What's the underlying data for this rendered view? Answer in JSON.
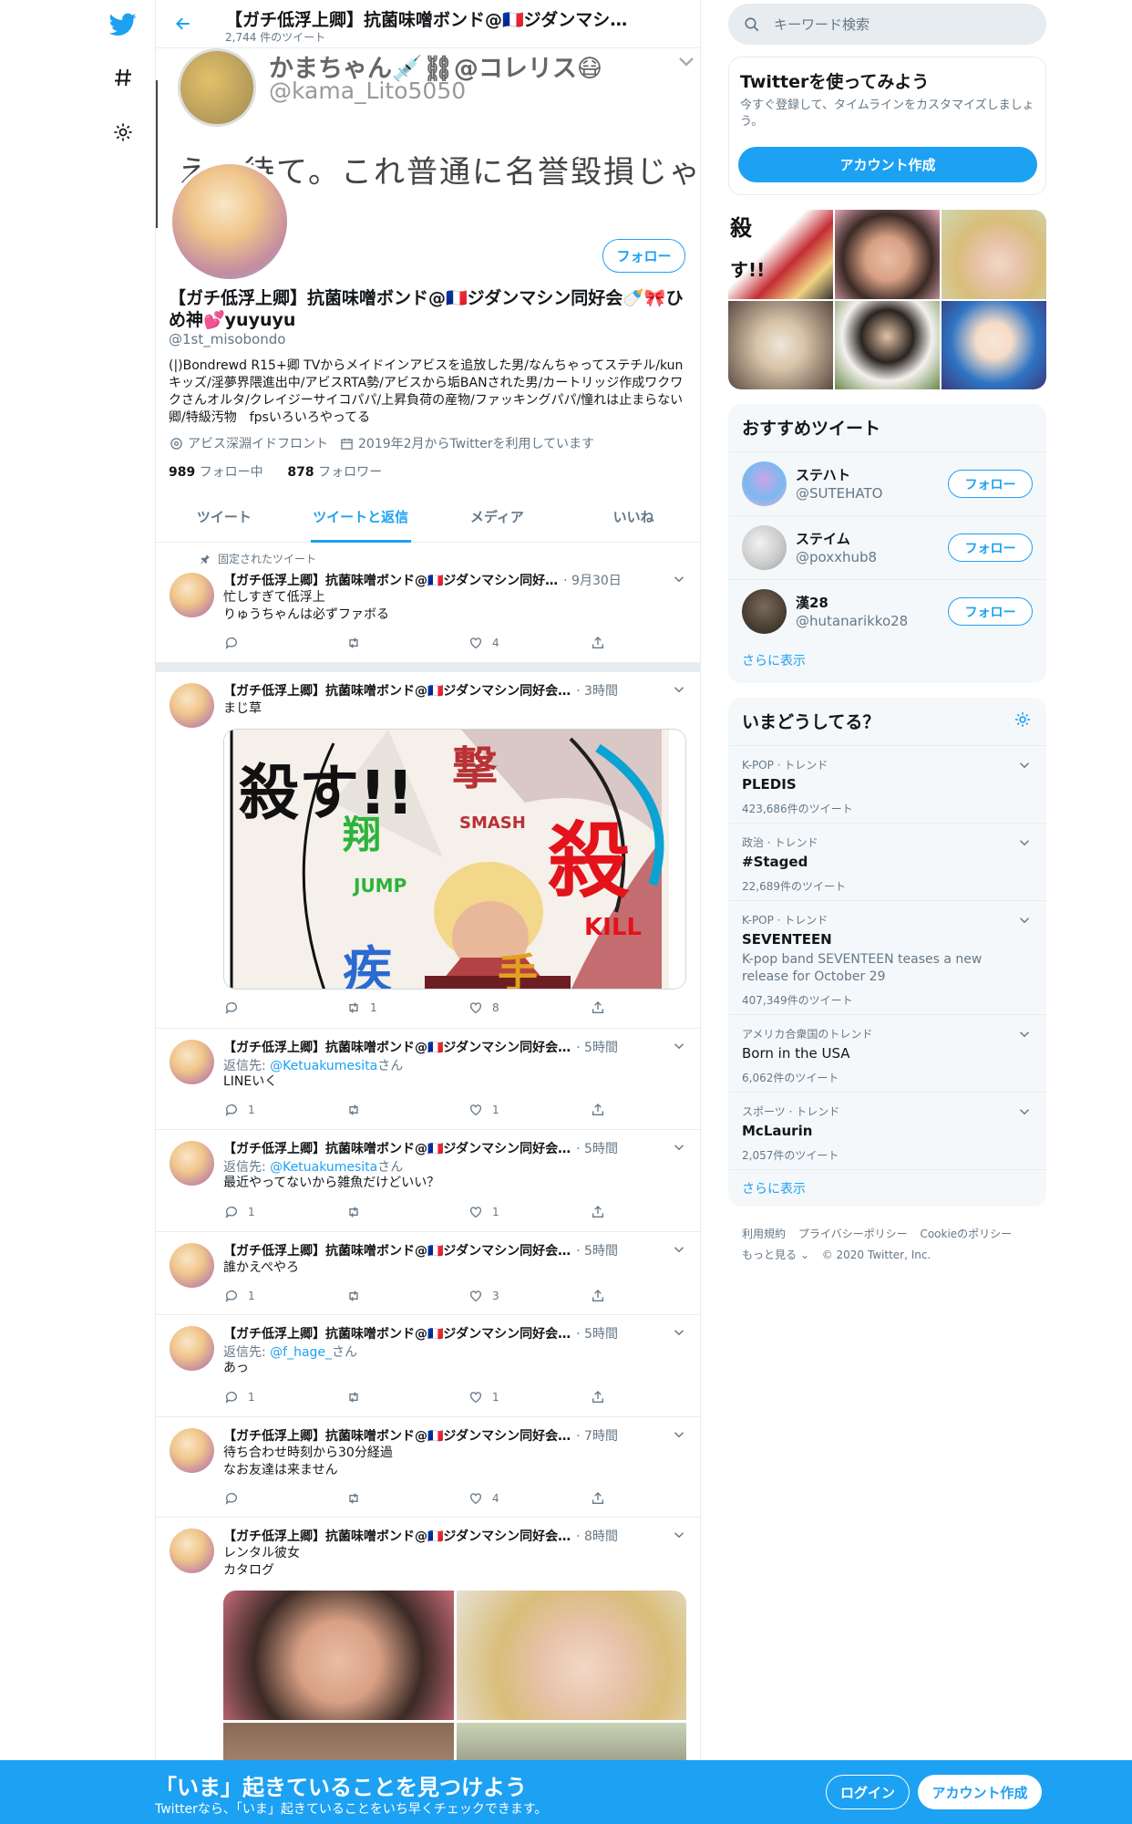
{
  "header": {
    "title": "【ガチ低浮上卿】抗菌味噌ボンド@🇫🇷ジダンマシ…",
    "tweet_count": "2,744 件のツイート"
  },
  "banner": {
    "name": "かまちゃん💉⛓@コレリス😷",
    "handle": "@kama_Lito5050",
    "body": "え、待て。これ普通に名誉毀損じゃ"
  },
  "profile": {
    "follow_label": "フォロー",
    "name": "【ガチ低浮上卿】抗菌味噌ボンド@🇫🇷ジダンマシン同好会🍼🎀ひめ神💕yuyuyu",
    "handle": "@1st_misobondo",
    "bio": "(|)Bondrewd R15+卿 TVからメイドインアビスを追放した男/なんちゃってステチル/kunキッズ/淫夢界隈進出中/アビスRTA勢/アビスから垢BANされた男/カートリッジ作成ワクワクさんオルタ/クレイジーサイコパパ/上昇負荷の産物/ファッキングパパ/憧れは止まらない卿/特級汚物　fpsいろいろやってる",
    "location": "アビス深淵イドフロント",
    "joined": "2019年2月からTwitterを利用しています",
    "following_count": "989",
    "following_label": "フォロー中",
    "followers_count": "878",
    "followers_label": "フォロワー"
  },
  "tabs": [
    "ツイート",
    "ツイートと返信",
    "メディア",
    "いいね"
  ],
  "pinned_label": "固定されたツイート",
  "tweets": [
    {
      "name": "【ガチ低浮上卿】抗菌味噌ボンド@🇫🇷ジダンマシン同好…",
      "time": "· 9月30日",
      "reply_prefix": "",
      "reply_to": "",
      "reply_suffix": "",
      "text": "忙しすぎて低浮上\nりゅうちゃんは必ずファボる",
      "replies": "",
      "retweets": "",
      "likes": "4"
    },
    {
      "name": "【ガチ低浮上卿】抗菌味噌ボンド@🇫🇷ジダンマシン同好会…",
      "time": "· 3時間",
      "reply_prefix": "",
      "reply_to": "",
      "reply_suffix": "",
      "text": "まじ草",
      "replies": "",
      "retweets": "1",
      "likes": "8",
      "media_text": {
        "a": "殺す!!",
        "b": "翔",
        "b2": "JUMP",
        "c": "撃",
        "c2": "SMASH",
        "d": "殺",
        "d2": "KILL",
        "e": "疾",
        "f": "手"
      }
    },
    {
      "name": "【ガチ低浮上卿】抗菌味噌ボンド@🇫🇷ジダンマシン同好会…",
      "time": "· 5時間",
      "reply_prefix": "返信先: ",
      "reply_to": "@Ketuakumesita",
      "reply_suffix": "さん",
      "text": "LINEいく",
      "replies": "1",
      "retweets": "",
      "likes": "1"
    },
    {
      "name": "【ガチ低浮上卿】抗菌味噌ボンド@🇫🇷ジダンマシン同好会…",
      "time": "· 5時間",
      "reply_prefix": "返信先: ",
      "reply_to": "@Ketuakumesita",
      "reply_suffix": "さん",
      "text": "最近やってないから雑魚だけどいい？",
      "replies": "1",
      "retweets": "",
      "likes": "1"
    },
    {
      "name": "【ガチ低浮上卿】抗菌味噌ボンド@🇫🇷ジダンマシン同好会…",
      "time": "· 5時間",
      "reply_prefix": "",
      "reply_to": "",
      "reply_suffix": "",
      "text": "誰かえぺやろ",
      "replies": "1",
      "retweets": "",
      "likes": "3"
    },
    {
      "name": "【ガチ低浮上卿】抗菌味噌ボンド@🇫🇷ジダンマシン同好会…",
      "time": "· 5時間",
      "reply_prefix": "返信先: ",
      "reply_to": "@f_hage_",
      "reply_suffix": "さん",
      "text": "あっ",
      "replies": "1",
      "retweets": "",
      "likes": "1"
    },
    {
      "name": "【ガチ低浮上卿】抗菌味噌ボンド@🇫🇷ジダンマシン同好会…",
      "time": "· 7時間",
      "reply_prefix": "",
      "reply_to": "",
      "reply_suffix": "",
      "text": "待ち合わせ時刻から30分経過\nなお友達は来ません",
      "replies": "",
      "retweets": "",
      "likes": "4"
    },
    {
      "name": "【ガチ低浮上卿】抗菌味噌ボンド@🇫🇷ジダンマシン同好会…",
      "time": "· 8時間",
      "reply_prefix": "",
      "reply_to": "",
      "reply_suffix": "",
      "text": "レンタル彼女\nカタログ",
      "replies": "",
      "retweets": "",
      "likes": ""
    }
  ],
  "right": {
    "search_placeholder": "キーワード検索",
    "signup_title": "Twitterを使ってみよう",
    "signup_desc": "今すぐ登録して、タイムラインをカスタマイズしましょう。",
    "signup_button": "アカウント作成",
    "gallery_text": {
      "g1": "殺",
      "g2": "す!!"
    },
    "suggest_title": "おすすめツイート",
    "suggestions": [
      {
        "name": "ステハト",
        "handle": "@SUTEHATO",
        "button": "フォロー"
      },
      {
        "name": "ステイム",
        "handle": "@poxxhub8",
        "button": "フォロー"
      },
      {
        "name": "漢28",
        "handle": "@hutanarikko28",
        "button": "フォロー"
      }
    ],
    "show_more": "さらに表示",
    "trends_title": "いまどうしてる？",
    "trends": [
      {
        "category": "K-POP · トレンド",
        "name": "PLEDIS",
        "desc": "",
        "count": "423,686件のツイート"
      },
      {
        "category": "政治 · トレンド",
        "name": "#Staged",
        "desc": "",
        "count": "22,689件のツイート"
      },
      {
        "category": "K-POP · トレンド",
        "name": "SEVENTEEN",
        "desc": "K-pop band SEVENTEEN teases a new release for October 29",
        "count": "407,349件のツイート"
      },
      {
        "category": "アメリカ合衆国のトレンド",
        "name": "Born in the USA",
        "desc": "",
        "count": "6,062件のツイート"
      },
      {
        "category": "スポーツ · トレンド",
        "name": "McLaurin",
        "desc": "",
        "count": "2,057件のツイート"
      }
    ],
    "trends_more": "さらに表示",
    "footer": {
      "terms": "利用規約",
      "privacy": "プライバシーポリシー",
      "cookie": "Cookieのポリシー",
      "more": "もっと見る ⌄",
      "copyright": "© 2020 Twitter, Inc."
    }
  },
  "bottom": {
    "title": "「いま」起きていることを見つけよう",
    "subtitle": "Twitterなら、「いま」起きていることをいち早くチェックできます。",
    "login": "ログイン",
    "signup": "アカウント作成"
  },
  "colors": {
    "accent": "#1da1f2",
    "text": "#14171a",
    "muted": "#657786",
    "border": "#e6ecf0"
  }
}
